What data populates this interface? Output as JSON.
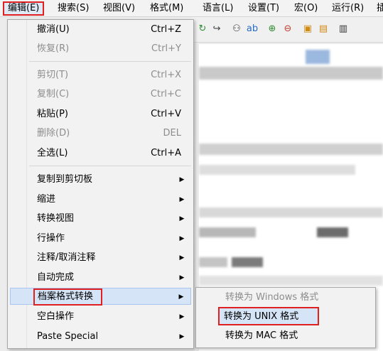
{
  "menubar": {
    "items": [
      "编辑(E)",
      "搜索(S)",
      "视图(V)",
      "格式(M)",
      "语言(L)",
      "设置(T)",
      "宏(O)",
      "运行(R)",
      "插"
    ],
    "active_index": 0
  },
  "toolbar": {
    "icons": [
      "redo-icon",
      "binoculars-icon",
      "find-replace-icon",
      "zoom-in-icon",
      "zoom-out-icon",
      "sync-icon",
      "wrap-icon"
    ]
  },
  "edit_menu": {
    "undo": {
      "label": "撤消(U)",
      "shortcut": "Ctrl+Z"
    },
    "redo": {
      "label": "恢复(R)",
      "shortcut": "Ctrl+Y"
    },
    "cut": {
      "label": "剪切(T)",
      "shortcut": "Ctrl+X"
    },
    "copy": {
      "label": "复制(C)",
      "shortcut": "Ctrl+C"
    },
    "paste": {
      "label": "粘贴(P)",
      "shortcut": "Ctrl+V"
    },
    "delete": {
      "label": "删除(D)",
      "shortcut": "DEL"
    },
    "select_all": {
      "label": "全选(L)",
      "shortcut": "Ctrl+A"
    },
    "copy_to_clipboard": {
      "label": "复制到剪切板"
    },
    "indent": {
      "label": "缩进"
    },
    "convert_case": {
      "label": "转换视图"
    },
    "line_ops": {
      "label": "行操作"
    },
    "comment": {
      "label": "注释/取消注释"
    },
    "auto_complete": {
      "label": "自动完成"
    },
    "eol_conversion": {
      "label": "档案格式转换"
    },
    "blank_ops": {
      "label": "空白操作"
    },
    "paste_special": {
      "label": "Paste Special"
    }
  },
  "eol_submenu": {
    "windows": "转换为 Windows 格式",
    "unix": "转换为 UNIX 格式",
    "mac": "转换为 MAC 格式"
  },
  "colors": {
    "highlight": "#d5e4f6",
    "annotation_red": "#e02020"
  }
}
